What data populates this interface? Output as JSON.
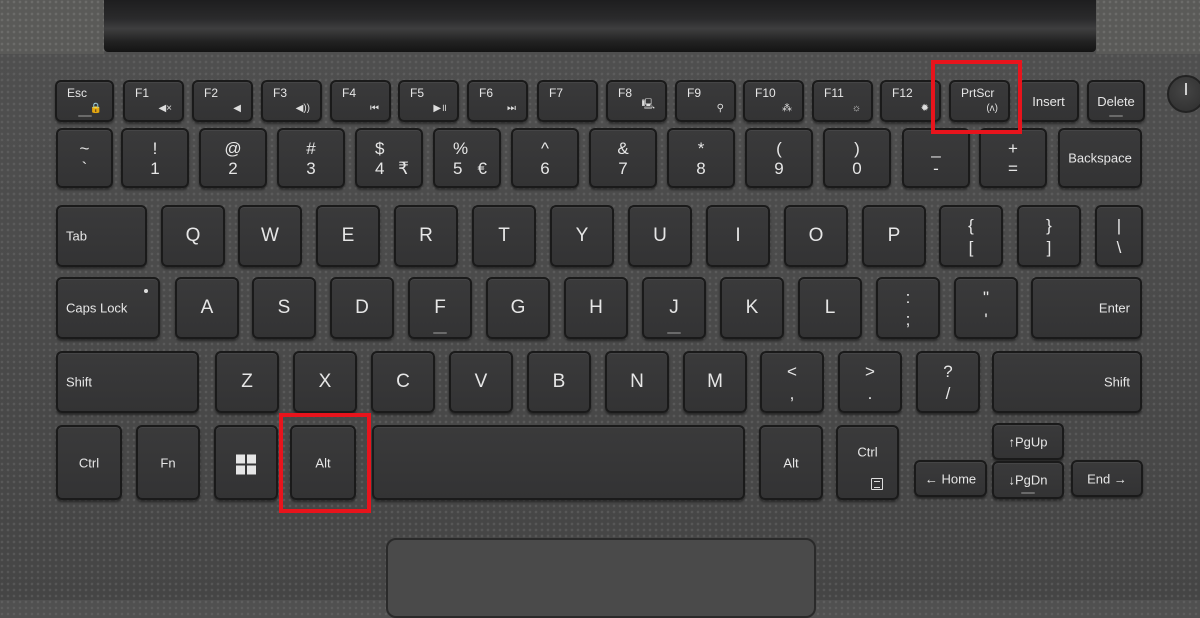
{
  "image": {
    "subject": "Laptop keyboard with PrtScr and Alt keys highlighted",
    "highlight_color": "#e8141c",
    "highlighted_keys": [
      "PrtScr",
      "Alt"
    ]
  },
  "rows": {
    "function": [
      {
        "label": "Esc",
        "sub": "🔒"
      },
      {
        "label": "F1",
        "sub": "◀×"
      },
      {
        "label": "F2",
        "sub": "◀"
      },
      {
        "label": "F3",
        "sub": "◀))"
      },
      {
        "label": "F4",
        "sub": "⏮"
      },
      {
        "label": "F5",
        "sub": "▶॥"
      },
      {
        "label": "F6",
        "sub": "⏭"
      },
      {
        "label": "F7",
        "sub": ""
      },
      {
        "label": "F8",
        "sub": "🖳"
      },
      {
        "label": "F9",
        "sub": "⚲"
      },
      {
        "label": "F10",
        "sub": "⁂"
      },
      {
        "label": "F11",
        "sub": "☼"
      },
      {
        "label": "F12",
        "sub": "✹"
      },
      {
        "label": "PrtScr",
        "sub": "(ᴧ)"
      },
      {
        "label": "Insert",
        "sub": ""
      },
      {
        "label": "Delete",
        "sub": ""
      }
    ],
    "number": [
      {
        "top": "~",
        "bottom": "`"
      },
      {
        "top": "!",
        "bottom": "1"
      },
      {
        "top": "@",
        "bottom": "2"
      },
      {
        "top": "#",
        "bottom": "3"
      },
      {
        "top": "$",
        "bottom": "4",
        "alt": "₹"
      },
      {
        "top": "%",
        "bottom": "5",
        "alt": "€"
      },
      {
        "top": "^",
        "bottom": "6"
      },
      {
        "top": "&",
        "bottom": "7"
      },
      {
        "top": "*",
        "bottom": "8"
      },
      {
        "top": "(",
        "bottom": "9"
      },
      {
        "top": ")",
        "bottom": "0"
      },
      {
        "top": "_",
        "bottom": "-"
      },
      {
        "top": "+",
        "bottom": "="
      },
      {
        "label": "Backspace"
      }
    ],
    "qwerty": [
      {
        "label": "Tab"
      },
      {
        "label": "Q"
      },
      {
        "label": "W"
      },
      {
        "label": "E"
      },
      {
        "label": "R"
      },
      {
        "label": "T"
      },
      {
        "label": "Y"
      },
      {
        "label": "U"
      },
      {
        "label": "I"
      },
      {
        "label": "O"
      },
      {
        "label": "P"
      },
      {
        "top": "{",
        "bottom": "["
      },
      {
        "top": "}",
        "bottom": "]"
      },
      {
        "top": "|",
        "bottom": "\\"
      }
    ],
    "home": [
      {
        "label": "Caps Lock"
      },
      {
        "label": "A"
      },
      {
        "label": "S"
      },
      {
        "label": "D"
      },
      {
        "label": "F"
      },
      {
        "label": "G"
      },
      {
        "label": "H"
      },
      {
        "label": "J"
      },
      {
        "label": "K"
      },
      {
        "label": "L"
      },
      {
        "top": ":",
        "bottom": ";"
      },
      {
        "top": "\"",
        "bottom": "'"
      },
      {
        "label": "Enter"
      }
    ],
    "shift": [
      {
        "label": "Shift"
      },
      {
        "label": "Z"
      },
      {
        "label": "X"
      },
      {
        "label": "C"
      },
      {
        "label": "V"
      },
      {
        "label": "B"
      },
      {
        "label": "N"
      },
      {
        "label": "M"
      },
      {
        "top": "<",
        "bottom": ","
      },
      {
        "top": ">",
        "bottom": "."
      },
      {
        "top": "?",
        "bottom": "/"
      },
      {
        "label": "Shift"
      }
    ],
    "bottom": [
      {
        "label": "Ctrl"
      },
      {
        "label": "Fn"
      },
      {
        "label": "",
        "icon": "windows-logo"
      },
      {
        "label": "Alt"
      },
      {
        "label": ""
      },
      {
        "label": "Alt"
      },
      {
        "label": "Ctrl"
      },
      {
        "label": "← Home"
      },
      {
        "label": "↑PgUp"
      },
      {
        "label": "↓PgDn"
      },
      {
        "label": "End →"
      }
    ]
  }
}
